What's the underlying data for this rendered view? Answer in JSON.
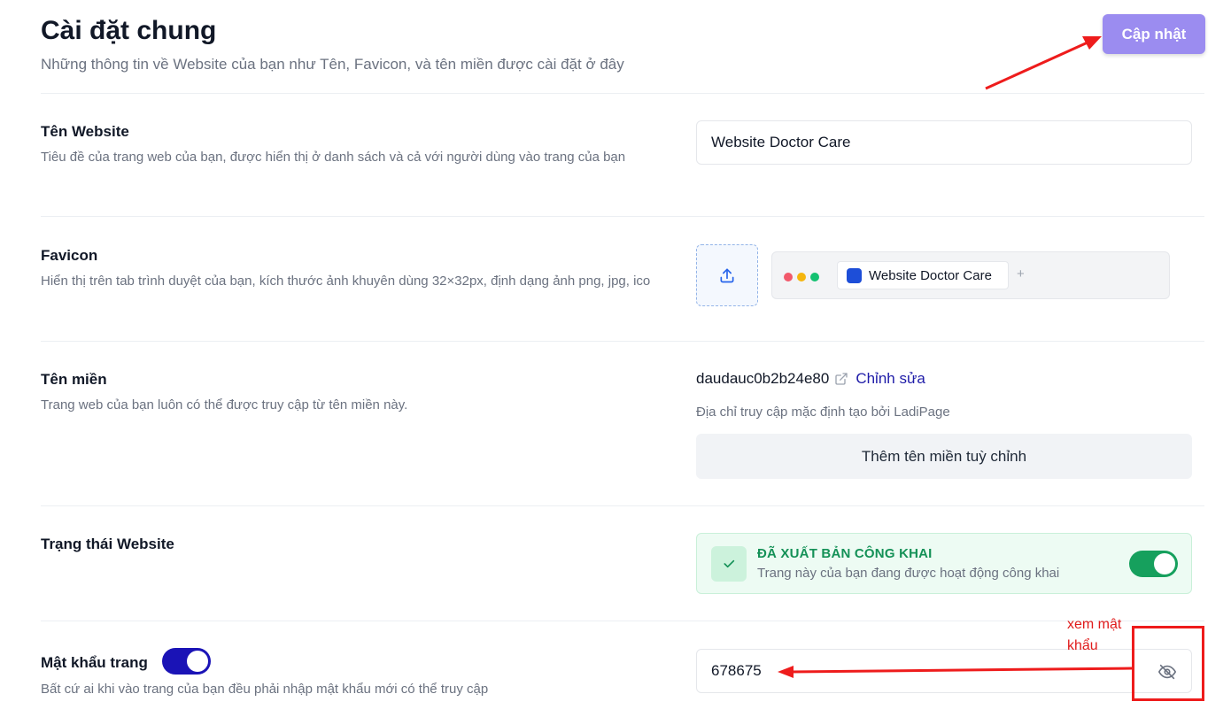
{
  "header": {
    "title": "Cài đặt chung",
    "subtitle": "Những thông tin về Website của bạn như Tên, Favicon, và tên miền được cài đặt ở đây",
    "update_label": "Cập nhật"
  },
  "website_name": {
    "title": "Tên Website",
    "description": "Tiêu đề của trang web của bạn, được hiển thị ở danh sách và cả với người dùng vào trang của bạn",
    "value": "Website Doctor Care"
  },
  "favicon": {
    "title": "Favicon",
    "description": "Hiển thị trên tab trình duyệt của bạn, kích thước ảnh khuyên dùng 32×32px, định dạng ảnh png, jpg, ico",
    "upload_icon": "upload-icon",
    "preview_tab_label": "Website Doctor Care",
    "preview_plus": "+"
  },
  "domain": {
    "title": "Tên miền",
    "description": "Trang web của bạn luôn có thể được truy cập từ tên miền này.",
    "value": "daudauc0b2b24e80",
    "edit_label": "Chỉnh sửa",
    "hint": "Địa chỉ truy cập mặc định tạo bởi LadiPage",
    "add_custom_label": "Thêm tên miền tuỳ chỉnh"
  },
  "status": {
    "title": "Trạng thái Website",
    "badge_title": "ĐÃ XUẤT BẢN CÔNG KHAI",
    "badge_desc": "Trang này của bạn đang được hoạt động công khai",
    "published": true
  },
  "password": {
    "title": "Mật khẩu trang",
    "description": "Bất cứ ai khi vào trang của bạn đều phải nhập mật khẩu mới có thể truy cập",
    "enabled": true,
    "value": "678675"
  },
  "annotation": {
    "label": "xem mật khẩu"
  },
  "colors": {
    "accent": "#9b8cf0",
    "link": "#1e1ba8",
    "success": "#149157",
    "toggle_on_green": "#16a05d",
    "toggle_on_blue": "#1a13b6",
    "annotation_red": "#ee1c1c"
  }
}
